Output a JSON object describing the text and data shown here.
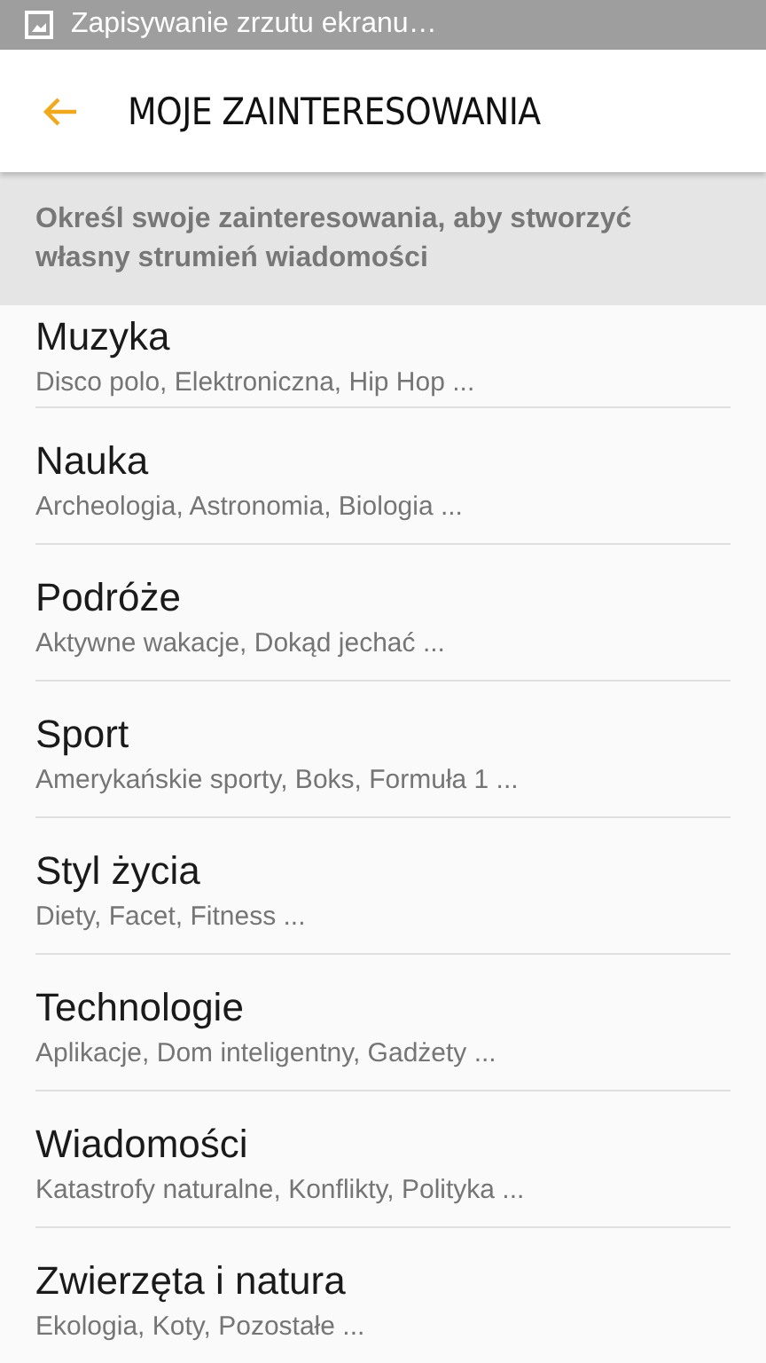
{
  "status_bar": {
    "notification": "Zapisywanie zrzutu ekranu…"
  },
  "header": {
    "title": "MOJE ZAINTERESOWANIA"
  },
  "banner": {
    "text": "Określ swoje zainteresowania, aby stworzyć własny strumień wiadomości"
  },
  "categories": [
    {
      "title": "Muzyka",
      "subtitle": "Disco polo, Elektroniczna, Hip Hop ..."
    },
    {
      "title": "Nauka",
      "subtitle": "Archeologia, Astronomia, Biologia ..."
    },
    {
      "title": "Podróże",
      "subtitle": "Aktywne wakacje, Dokąd jechać ..."
    },
    {
      "title": "Sport",
      "subtitle": "Amerykańskie sporty, Boks, Formuła 1 ..."
    },
    {
      "title": "Styl życia",
      "subtitle": "Diety, Facet, Fitness ..."
    },
    {
      "title": "Technologie",
      "subtitle": "Aplikacje, Dom inteligentny, Gadżety ..."
    },
    {
      "title": "Wiadomości",
      "subtitle": "Katastrofy naturalne, Konflikty, Polityka ..."
    },
    {
      "title": "Zwierzęta i natura",
      "subtitle": "Ekologia, Koty, Pozostałe ..."
    }
  ]
}
